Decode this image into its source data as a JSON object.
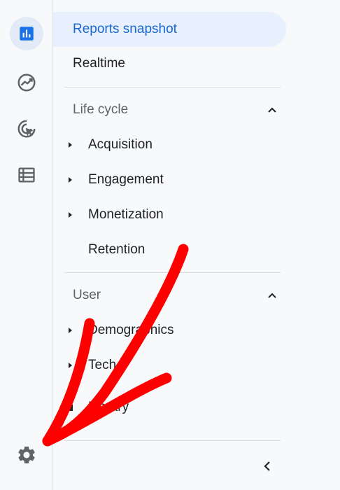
{
  "rail": {
    "items": [
      {
        "icon": "bar-chart-icon",
        "active": true
      },
      {
        "icon": "trending-icon",
        "active": false
      },
      {
        "icon": "cursor-target-icon",
        "active": false
      },
      {
        "icon": "list-table-icon",
        "active": false
      }
    ],
    "settings_icon": "gear-icon"
  },
  "nav": {
    "reports_snapshot": "Reports snapshot",
    "realtime": "Realtime",
    "life_cycle": {
      "title": "Life cycle",
      "items": [
        "Acquisition",
        "Engagement",
        "Monetization",
        "Retention"
      ]
    },
    "user": {
      "title": "User",
      "items": [
        "Demographics",
        "Tech",
        "Library"
      ]
    },
    "collapse_icon": "chevron-left-icon"
  },
  "annotation": {
    "type": "red-arrow",
    "color": "#ff0000",
    "points_to": "gear-icon"
  },
  "colors": {
    "accent": "#1967d2",
    "active_bg": "#e8f0fe",
    "text": "#202124",
    "muted": "#5f6368"
  }
}
